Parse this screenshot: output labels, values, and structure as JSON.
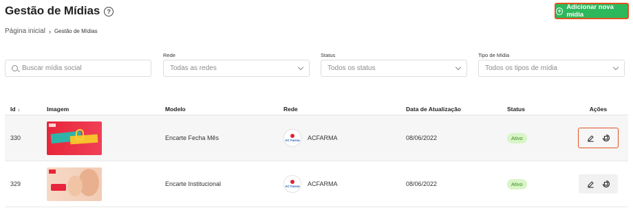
{
  "header": {
    "title": "Gestão de Mídias",
    "help_icon": "question-circle-icon",
    "add_button_label": "Adicionar nova mídia",
    "add_button_color": "#2eb85c"
  },
  "breadcrumb": {
    "home": "Página inicial",
    "separator": "›",
    "current": "Gestão de Mídias"
  },
  "filters": {
    "search_placeholder": "Buscar mídia social",
    "rede": {
      "label": "Rede",
      "value": "Todas as redes"
    },
    "status": {
      "label": "Status",
      "value": "Todos os status"
    },
    "tipo": {
      "label": "Tipo de Mídia",
      "value": "Todos os tipos de mídia"
    }
  },
  "table": {
    "columns": {
      "id": "Id",
      "sort_indicator": "↓",
      "imagem": "Imagem",
      "modelo": "Modelo",
      "rede": "Rede",
      "data": "Data de Atualização",
      "status": "Status",
      "acoes": "Ações"
    },
    "rows": [
      {
        "id": "330",
        "modelo": "Encarte Fecha Mês",
        "rede": "ACFARMA",
        "rede_logo_text": "AC Farma",
        "data": "08/06/2022",
        "status": "Ativo"
      },
      {
        "id": "329",
        "modelo": "Encarte Institucional",
        "rede": "ACFARMA",
        "rede_logo_text": "AC Farma",
        "data": "08/06/2022",
        "status": "Ativo"
      }
    ]
  },
  "colors": {
    "accent_green": "#2eb85c",
    "highlight_orange": "#e0531f",
    "status_bg": "#d8f5c7",
    "status_text": "#3b8a1e"
  }
}
